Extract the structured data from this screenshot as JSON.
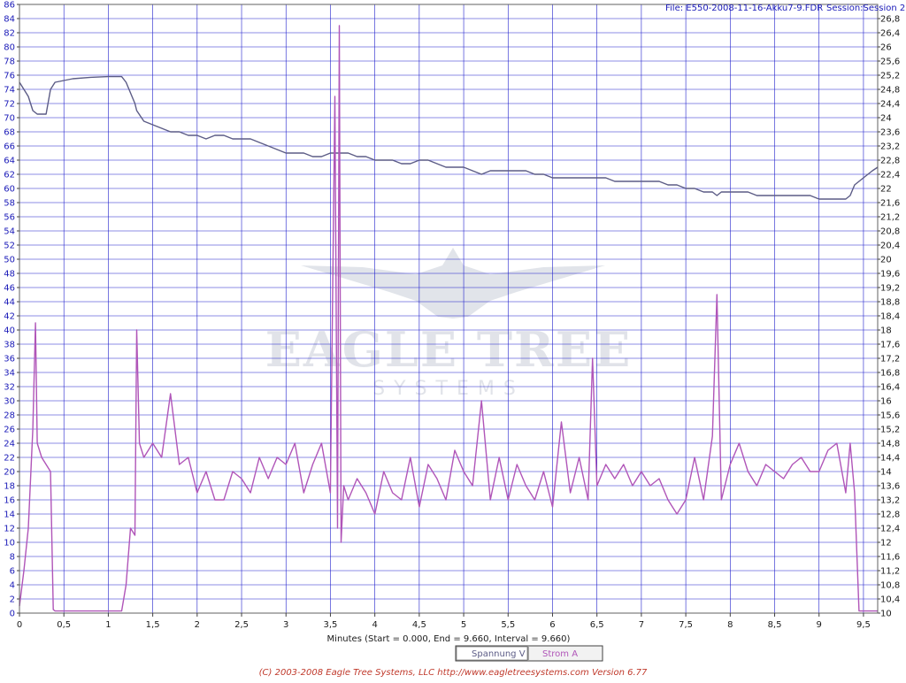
{
  "header": {
    "file_text": "File: E550-2008-11-16-Akku7-9.FDR",
    "session_text": "Session:Session 2"
  },
  "watermark": {
    "line1": "EAGLE TREE",
    "line2": "SYSTEMS"
  },
  "footer": {
    "text": "(C) 2003-2008 Eagle Tree Systems, LLC      http://www.eagletreesystems.com     Version 6.77"
  },
  "colors": {
    "voltage": "#5c5c86",
    "current": "#b055b8",
    "grid": "#1f1fcc",
    "footer": "#c0392b"
  },
  "chart_data": {
    "type": "line",
    "xlabel": "Minutes (Start = 0.000,  End = 9.660,  Interval =  9.660)",
    "xlim": [
      0,
      9.66
    ],
    "x_ticks": [
      "0",
      "0,5",
      "1",
      "1,5",
      "2",
      "2,5",
      "3",
      "3,5",
      "4",
      "4,5",
      "5",
      "5,5",
      "6",
      "6,5",
      "7",
      "7,5",
      "8",
      "8,5",
      "9",
      "9,5"
    ],
    "y_left_lim": [
      0,
      86
    ],
    "y_left_ticks": [
      "0",
      "2",
      "4",
      "6",
      "8",
      "10",
      "12",
      "14",
      "16",
      "18",
      "20",
      "22",
      "24",
      "26",
      "28",
      "30",
      "32",
      "34",
      "36",
      "38",
      "40",
      "42",
      "44",
      "46",
      "48",
      "50",
      "52",
      "54",
      "56",
      "58",
      "60",
      "62",
      "64",
      "66",
      "68",
      "70",
      "72",
      "74",
      "76",
      "78",
      "80",
      "82",
      "84",
      "86"
    ],
    "y_right_lim": [
      10,
      27.2
    ],
    "y_right_ticks": [
      "10",
      "10,4",
      "10,8",
      "11,2",
      "11,6",
      "12",
      "12,4",
      "12,8",
      "13,2",
      "13,6",
      "14",
      "14,4",
      "14,8",
      "15,2",
      "15,6",
      "16",
      "16,4",
      "16,8",
      "17,2",
      "17,6",
      "18",
      "18,4",
      "18,8",
      "19,2",
      "19,6",
      "20",
      "20,4",
      "20,8",
      "21,2",
      "21,6",
      "22",
      "22,4",
      "22,8",
      "23,2",
      "23,6",
      "24",
      "24,4",
      "24,8",
      "25,2",
      "25,6",
      "26",
      "26,4",
      "26,8"
    ],
    "grid": true,
    "legend": [
      "Spannung V",
      "Strom A"
    ],
    "series": [
      {
        "name": "Spannung V",
        "axis": "left",
        "x": [
          0,
          0.05,
          0.1,
          0.15,
          0.2,
          0.3,
          0.35,
          0.4,
          0.6,
          0.8,
          1.0,
          1.15,
          1.2,
          1.3,
          1.32,
          1.4,
          1.5,
          1.6,
          1.7,
          1.8,
          1.9,
          2.0,
          2.1,
          2.2,
          2.3,
          2.4,
          2.5,
          2.6,
          2.7,
          2.8,
          2.9,
          3.0,
          3.1,
          3.2,
          3.3,
          3.4,
          3.5,
          3.6,
          3.7,
          3.8,
          3.9,
          4.0,
          4.1,
          4.2,
          4.3,
          4.4,
          4.5,
          4.6,
          4.7,
          4.8,
          4.9,
          5.0,
          5.1,
          5.2,
          5.3,
          5.4,
          5.5,
          5.6,
          5.7,
          5.8,
          5.9,
          6.0,
          6.1,
          6.2,
          6.3,
          6.4,
          6.5,
          6.6,
          6.7,
          6.8,
          6.9,
          7.0,
          7.1,
          7.2,
          7.3,
          7.4,
          7.5,
          7.6,
          7.7,
          7.8,
          7.85,
          7.9,
          8.0,
          8.1,
          8.2,
          8.3,
          8.4,
          8.5,
          8.6,
          8.7,
          8.8,
          8.9,
          9.0,
          9.1,
          9.2,
          9.3,
          9.35,
          9.4,
          9.5,
          9.6,
          9.66
        ],
        "y": [
          75,
          74,
          73,
          71,
          70.5,
          70.5,
          74,
          75,
          75.5,
          75.7,
          75.8,
          75.8,
          75,
          72,
          71,
          69.5,
          69,
          68.5,
          68,
          68,
          67.5,
          67.5,
          67,
          67.5,
          67.5,
          67,
          67,
          67,
          66.5,
          66,
          65.5,
          65,
          65,
          65,
          64.5,
          64.5,
          65,
          65,
          65,
          64.5,
          64.5,
          64,
          64,
          64,
          63.5,
          63.5,
          64,
          64,
          63.5,
          63,
          63,
          63,
          62.5,
          62,
          62.5,
          62.5,
          62.5,
          62.5,
          62.5,
          62,
          62,
          61.5,
          61.5,
          61.5,
          61.5,
          61.5,
          61.5,
          61.5,
          61,
          61,
          61,
          61,
          61,
          61,
          60.5,
          60.5,
          60,
          60,
          59.5,
          59.5,
          59,
          59.5,
          59.5,
          59.5,
          59.5,
          59,
          59,
          59,
          59,
          59,
          59,
          59,
          58.5,
          58.5,
          58.5,
          58.5,
          59,
          60.5,
          61.5,
          62.5,
          63
        ]
      },
      {
        "name": "Strom A",
        "axis": "left",
        "x": [
          0,
          0.05,
          0.1,
          0.15,
          0.18,
          0.2,
          0.25,
          0.3,
          0.35,
          0.38,
          0.4,
          0.6,
          0.8,
          1.0,
          1.15,
          1.2,
          1.25,
          1.3,
          1.32,
          1.35,
          1.4,
          1.5,
          1.6,
          1.7,
          1.8,
          1.9,
          2.0,
          2.1,
          2.2,
          2.3,
          2.4,
          2.5,
          2.6,
          2.7,
          2.8,
          2.9,
          3.0,
          3.1,
          3.2,
          3.3,
          3.4,
          3.5,
          3.55,
          3.58,
          3.6,
          3.62,
          3.65,
          3.7,
          3.8,
          3.9,
          4.0,
          4.1,
          4.2,
          4.3,
          4.4,
          4.5,
          4.6,
          4.7,
          4.8,
          4.9,
          5.0,
          5.1,
          5.2,
          5.3,
          5.4,
          5.5,
          5.6,
          5.7,
          5.8,
          5.9,
          6.0,
          6.1,
          6.2,
          6.3,
          6.4,
          6.45,
          6.5,
          6.6,
          6.7,
          6.8,
          6.9,
          7.0,
          7.1,
          7.2,
          7.3,
          7.4,
          7.5,
          7.6,
          7.7,
          7.8,
          7.85,
          7.9,
          8.0,
          8.1,
          8.2,
          8.3,
          8.4,
          8.5,
          8.6,
          8.7,
          8.8,
          8.9,
          9.0,
          9.1,
          9.2,
          9.3,
          9.35,
          9.4,
          9.45,
          9.5,
          9.66
        ],
        "y": [
          1,
          6,
          12,
          26,
          41,
          24,
          22,
          21,
          20,
          0.5,
          0.3,
          0.3,
          0.3,
          0.3,
          0.3,
          4,
          12,
          11,
          40,
          24,
          22,
          24,
          22,
          31,
          21,
          22,
          17,
          20,
          16,
          16,
          20,
          19,
          17,
          22,
          19,
          22,
          21,
          24,
          17,
          21,
          24,
          17,
          73,
          12,
          83,
          10,
          18,
          16,
          19,
          17,
          14,
          20,
          17,
          16,
          22,
          15,
          21,
          19,
          16,
          23,
          20,
          18,
          30,
          16,
          22,
          16,
          21,
          18,
          16,
          20,
          15,
          27,
          17,
          22,
          16,
          36,
          18,
          21,
          19,
          21,
          18,
          20,
          18,
          19,
          16,
          14,
          16,
          22,
          16,
          25,
          45,
          16,
          21,
          24,
          20,
          18,
          21,
          20,
          19,
          21,
          22,
          20,
          20,
          23,
          24,
          17,
          24,
          17,
          0.3,
          0.3,
          0.3
        ]
      }
    ]
  }
}
